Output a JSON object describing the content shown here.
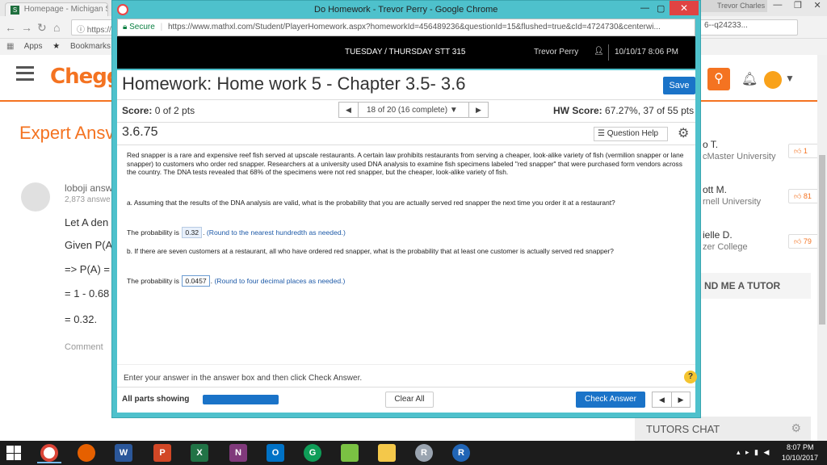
{
  "background_browser": {
    "tab_title": "Homepage - Michigan S",
    "profile_name": "Trevor Charles",
    "url_fragment": "https://",
    "url_suffix": "6--q24233...",
    "bookmarks": [
      "Apps",
      "Bookmarks"
    ]
  },
  "chegg": {
    "logo": "Chegg",
    "expert_title": "Expert Ansv",
    "answerer_name": "loboji answ",
    "answerer_count": "2,873 answe",
    "answer_lines": [
      "Let A den",
      "Given P(A",
      "=> P(A) =",
      "= 1 - 0.68",
      "= 0.32."
    ],
    "comment": "Comment",
    "tutors": [
      {
        "name": "o T.",
        "school": "cMaster University",
        "badge": "1"
      },
      {
        "name": "ott M.",
        "school": "rnell University",
        "badge": "81"
      },
      {
        "name": "ielle D.",
        "school": "zer College",
        "badge": "79"
      }
    ],
    "find_tutor": "ND ME A TUTOR",
    "tutors_chat": "TUTORS CHAT"
  },
  "popup": {
    "window_title": "Do Homework - Trevor Perry - Google Chrome",
    "secure_label": "Secure",
    "url": "https://www.mathxl.com/Student/PlayerHomework.aspx?homeworkId=456489236&questionId=15&flushed=true&cId=4724730&centerwi...",
    "course": "TUESDAY / THURSDAY STT 315",
    "student": "Trevor Perry",
    "datetime": "10/10/17 8:06 PM"
  },
  "homework": {
    "title": "Homework: Home work 5 - Chapter 3.5- 3.6",
    "save_label": "Save",
    "score_label": "Score:",
    "score_value": "0 of 2 pts",
    "question_progress": "18 of 20 (16 complete)",
    "hw_score_label": "HW Score:",
    "hw_score_value": "67.27%, 37 of 55 pts",
    "question_number": "3.6.75",
    "question_help": "Question Help",
    "question_body": "Red snapper is a rare and expensive reef fish served at upscale restaurants. A certain law prohibits restaurants from serving a cheaper, look-alike variety of fish (vermilion snapper or lane snapper) to customers who order red snapper. Researchers at a university used DNA analysis to examine fish specimens labeled \"red snapper\" that were purchased form vendors across the country. The DNA tests revealed that 68% of the specimens were not red snapper, but the cheaper, look-alike variety of fish.",
    "part_a": "a. Assuming that the results of the DNA analysis are valid, what is the probability that you are actually served red snapper the next time you order it at a restaurant?",
    "part_b": "b. If there are seven customers at a restaurant, all who have ordered red snapper, what is the probability that at least one customer is actually served red snapper?",
    "answer_prefix": "The probability is",
    "answer_a": "0.32",
    "hint_a": "(Round to the nearest hundredth as needed.)",
    "answer_b": "0.0457",
    "hint_b": "(Round to four decimal places as needed.)",
    "enter_instruction": "Enter your answer in the answer box and then click Check Answer.",
    "all_parts": "All parts showing",
    "clear_all": "Clear All",
    "check_answer": "Check Answer"
  },
  "taskbar": {
    "clock_time": "8:07 PM",
    "clock_date": "10/10/2017"
  },
  "colors": {
    "chegg_orange": "#f47321",
    "popup_frame": "#4ec1cc",
    "mathxl_blue": "#1a73c8"
  }
}
